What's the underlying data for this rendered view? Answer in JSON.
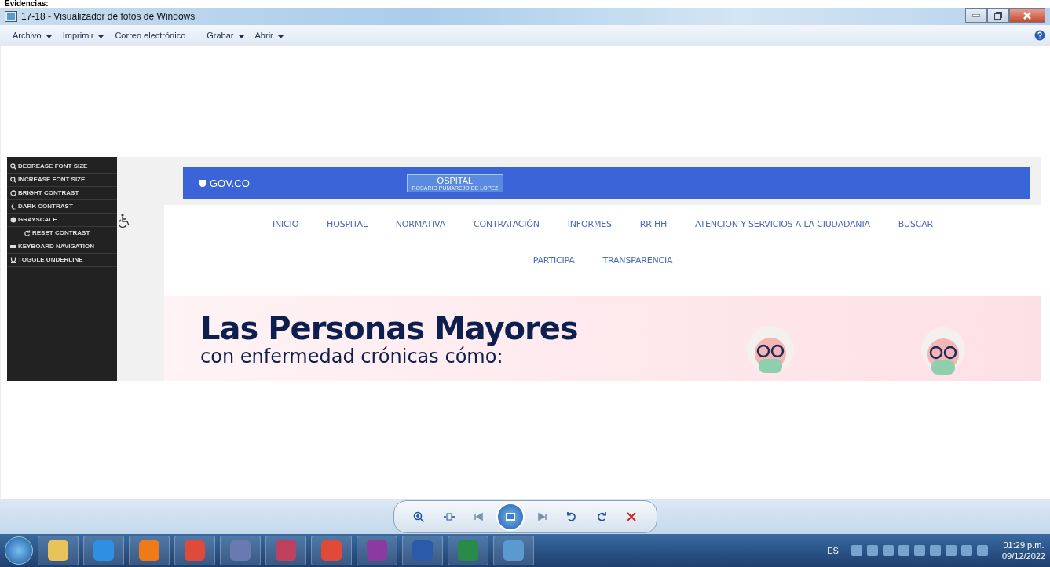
{
  "heading": "Evidencias:",
  "window": {
    "title": "17-18 - Visualizador de fotos de Windows"
  },
  "menu": [
    {
      "label": "Archivo",
      "dropdown": true
    },
    {
      "label": "Imprimir",
      "dropdown": true
    },
    {
      "label": "Correo electrónico",
      "dropdown": false
    },
    {
      "label": "Grabar",
      "dropdown": true
    },
    {
      "label": "Abrir",
      "dropdown": true
    }
  ],
  "photo": {
    "accessibility_menu": [
      {
        "label": "DECREASE FONT SIZE",
        "underline": false
      },
      {
        "label": "INCREASE FONT SIZE",
        "underline": false
      },
      {
        "label": "BRIGHT CONTRAST",
        "underline": false
      },
      {
        "label": "DARK CONTRAST",
        "underline": false
      },
      {
        "label": "GRAYSCALE",
        "underline": false
      },
      {
        "label": "RESET CONTRAST",
        "underline": true
      },
      {
        "label": "KEYBOARD NAVIGATION",
        "underline": false
      },
      {
        "label": "TOGGLE UNDERLINE",
        "underline": false
      }
    ],
    "gov_logo": "GOV.CO",
    "hospital_logo": {
      "name": "OSPITAL",
      "subtitle": "ROSARIO PUMAREJO DE LÓPEZ"
    },
    "nav_rows": [
      [
        "INICIO",
        "HOSPITAL",
        "NORMATIVA",
        "CONTRATACIÓN",
        "INFORMES",
        "RR HH",
        "ATENCION Y SERVICIOS A LA CIUDADANIA",
        "BUSCAR"
      ],
      [
        "PARTICIPA",
        "TRANSPARENCIA"
      ]
    ],
    "banner": {
      "title": "Las Personas Mayores",
      "subtitle": "con enfermedad crónicas cómo:"
    }
  },
  "taskbar": {
    "language": "ES",
    "time": "01:29 p.m.",
    "date": "09/12/2022"
  }
}
